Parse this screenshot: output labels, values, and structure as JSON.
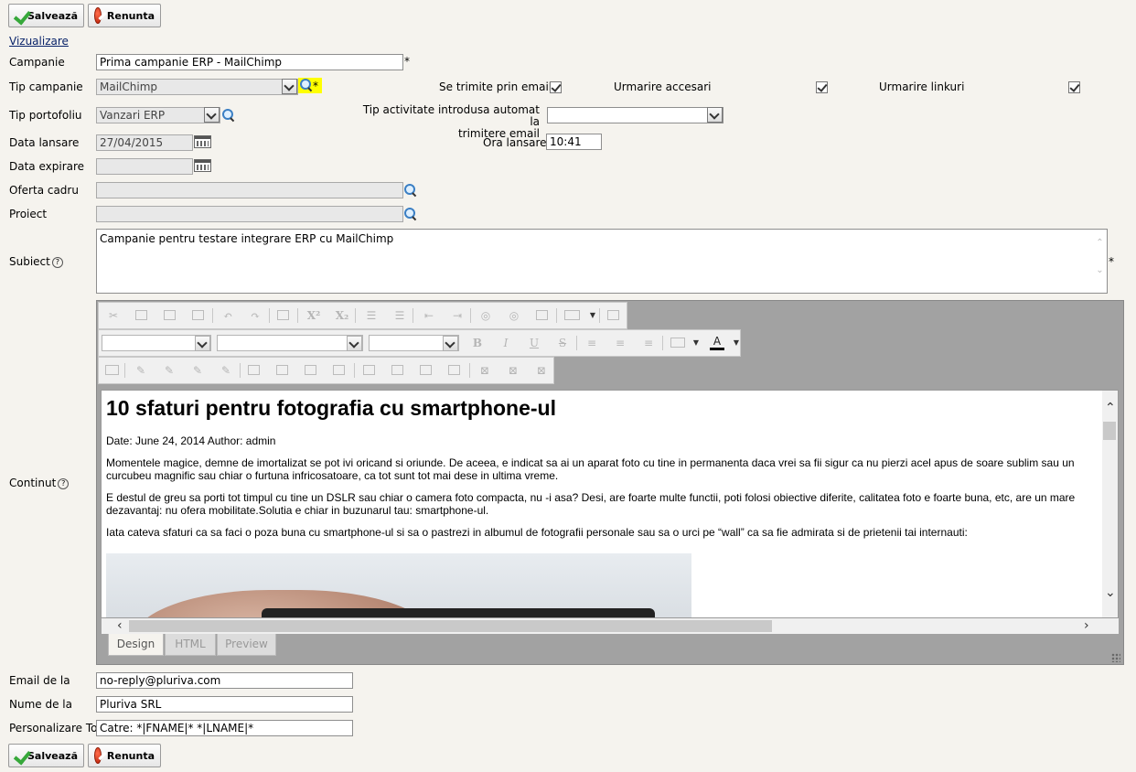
{
  "buttons": {
    "save": "Salvează",
    "cancel": "Renunta"
  },
  "view_link": "Vizualizare",
  "form": {
    "campanie": {
      "label": "Campanie",
      "value": "Prima campanie ERP - MailChimp"
    },
    "tip_campanie": {
      "label": "Tip campanie",
      "value": "MailChimp"
    },
    "required_mark": "*",
    "se_trimite": {
      "label": "Se trimite prin email"
    },
    "urmarire_accesari": {
      "label": "Urmarire accesari"
    },
    "urmarire_linkuri": {
      "label": "Urmarire linkuri"
    },
    "tip_portofoliu": {
      "label": "Tip portofoliu",
      "value": "Vanzari ERP"
    },
    "tip_activitate": {
      "label_line1": "Tip activitate introdusa automat la",
      "label_line2": "trimitere email",
      "value": ""
    },
    "data_lansare": {
      "label": "Data lansare",
      "value": "27/04/2015"
    },
    "ora_lansare": {
      "label": "Ora lansare",
      "value": "10:41"
    },
    "data_expirare": {
      "label": "Data expirare",
      "value": ""
    },
    "oferta_cadru": {
      "label": "Oferta cadru",
      "value": ""
    },
    "proiect": {
      "label": "Proiect",
      "value": ""
    },
    "subiect": {
      "label": "Subiect",
      "value": "Campanie pentru testare integrare ERP cu MailChimp"
    },
    "continut": {
      "label": "Continut"
    },
    "email_de_la": {
      "label": "Email de la",
      "value": "no-reply@pluriva.com"
    },
    "nume_de_la": {
      "label": "Nume de la",
      "value": "Pluriva SRL"
    },
    "personalizare_to": {
      "label": "Personalizare To",
      "value": "Catre: *|FNAME|* *|LNAME|*"
    }
  },
  "editor": {
    "tabs": [
      "Design",
      "HTML",
      "Preview"
    ],
    "format_buttons": {
      "bold": "B",
      "italic": "I",
      "underline": "U",
      "strike": "S",
      "font_color": "A",
      "superscript": "X²",
      "subscript": "X₂"
    },
    "content": {
      "title": "10 sfaturi pentru fotografia cu smartphone-ul",
      "meta": "Date: June 24, 2014 Author: admin",
      "p1": "Momentele magice, demne de imortalizat se pot ivi oricand si oriunde. De aceea, e indicat sa ai un aparat foto cu tine in permanenta daca vrei sa fii sigur ca nu pierzi acel apus de soare sublim sau un curcubeu magnific sau chiar o furtuna infricosatoare, ca tot sunt tot mai dese in ultima vreme.",
      "p2": "E destul de greu sa porti tot timpul cu tine un DSLR sau chiar o camera foto compacta, nu -i asa? Desi, are foarte multe functii, poti folosi obiective diferite, calitatea foto e foarte buna, etc, are un mare dezavantaj: nu ofera mobilitate.Solutia e chiar in buzunarul tau: smartphone-ul.",
      "p3": "Iata cateva sfaturi ca sa faci o poza buna cu smartphone-ul si sa o pastrezi in albumul de fotografii personale sau sa o urci pe “wall” ca sa fie admirata si de prietenii tai internauti:"
    }
  },
  "colors": {
    "lookup_highlight": "#ffff00",
    "check_green": "#36a83a",
    "cancel_red": "#d2301a",
    "link_blue": "#0a246a"
  }
}
